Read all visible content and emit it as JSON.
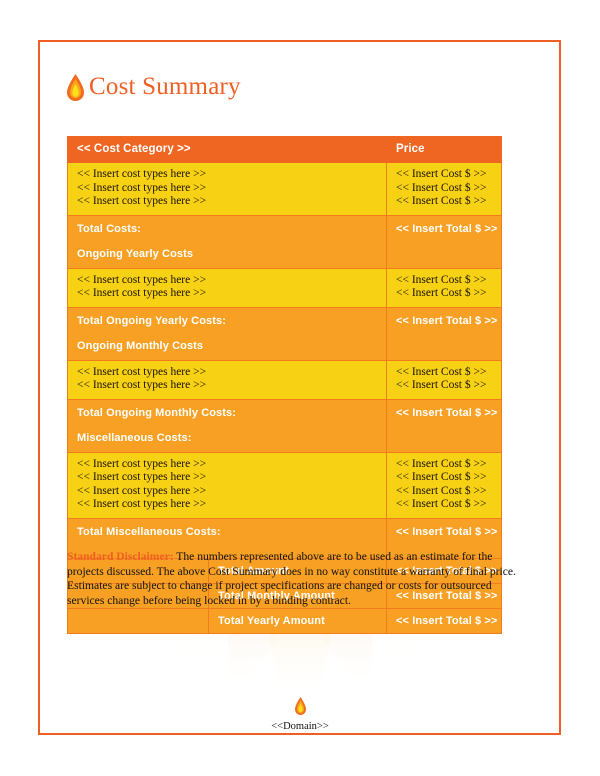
{
  "document": {
    "title": "Cost Summary",
    "logo_icon": "flame-icon"
  },
  "table": {
    "header": {
      "category": "<< Cost Category >>",
      "price": "Price"
    },
    "sections": [
      {
        "type": "items",
        "rows": [
          {
            "label": "<< Insert cost types here >>",
            "price": "<< Insert Cost $ >>"
          },
          {
            "label": "<< Insert cost types here >>",
            "price": "<< Insert Cost $ >>"
          },
          {
            "label": "<< Insert cost types here >>",
            "price": "<< Insert Cost $ >>"
          }
        ]
      },
      {
        "type": "total",
        "total_label": "Total Costs:",
        "next_section_label": "Ongoing Yearly Costs",
        "price": "<< Insert Total $ >>"
      },
      {
        "type": "items",
        "rows": [
          {
            "label": "<< Insert cost types here >>",
            "price": "<< Insert Cost $ >>"
          },
          {
            "label": "<< Insert cost types here >>",
            "price": "<< Insert Cost $ >>"
          }
        ]
      },
      {
        "type": "total",
        "total_label": "Total Ongoing Yearly Costs:",
        "next_section_label": "Ongoing Monthly Costs",
        "price": "<< Insert Total $ >>"
      },
      {
        "type": "items",
        "rows": [
          {
            "label": "<< Insert cost types here >>",
            "price": "<< Insert Cost $ >>"
          },
          {
            "label": "<< Insert cost types here >>",
            "price": "<< Insert Cost $ >>"
          }
        ]
      },
      {
        "type": "total",
        "total_label": "Total Ongoing Monthly Costs:",
        "next_section_label": "Miscellaneous Costs:",
        "price": "<< Insert Total $ >>"
      },
      {
        "type": "items",
        "rows": [
          {
            "label": "<< Insert cost types here >>",
            "price": "<< Insert Cost $ >>"
          },
          {
            "label": "<< Insert cost types here >>",
            "price": "<< Insert Cost $ >>"
          },
          {
            "label": "<< Insert cost types here >>",
            "price": "<< Insert Cost $ >>"
          },
          {
            "label": "<< Insert cost types here >>",
            "price": "<< Insert Cost $ >>"
          }
        ]
      },
      {
        "type": "total",
        "total_label": "Total Miscellaneous Costs:",
        "next_section_label": "",
        "price": "<< Insert Total $ >>"
      }
    ],
    "footer_rows": [
      {
        "label": "Total Amount",
        "price": "<< Insert Total $ >>"
      },
      {
        "label": "Total Monthly Amount",
        "price": "<< Insert Total $ >>"
      },
      {
        "label": "Total Yearly Amount",
        "price": "<< Insert Total $ >>"
      }
    ]
  },
  "disclaimer": {
    "label": "Standard Disclaimer:",
    "body": " The numbers represented above are to be used as an estimate for the projects discussed. The above Cost Summary does in no way constitute a warranty of final price.  Estimates are subject to change if project specifications are changed or costs for outsourced services change before being locked in by a binding contract."
  },
  "footer": {
    "icon": "flame-icon",
    "text": "<<Domain>>"
  },
  "colors": {
    "accent_orange": "#EF5F24",
    "header_orange": "#EE6622",
    "section_orange": "#F7A024",
    "item_yellow": "#F7D113",
    "border_orange": "#F07C1E",
    "text_dark": "#111111"
  }
}
